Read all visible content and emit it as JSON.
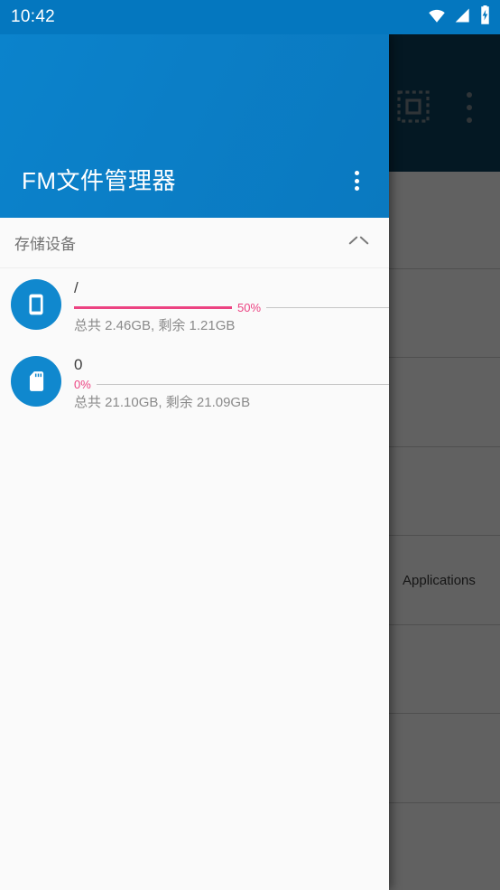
{
  "status_bar": {
    "time": "10:42",
    "icons": [
      "wifi-icon",
      "cellular-signal-icon",
      "battery-charging-icon"
    ],
    "background": "#0477bf"
  },
  "background_app": {
    "toolbar": {
      "background": "#0b3f5e",
      "select_all_icon": "select-all-icon",
      "overflow_icon": "overflow-menu-icon"
    },
    "list_rows": [
      {
        "label": ""
      },
      {
        "label": ""
      },
      {
        "label": ""
      },
      {
        "label": ""
      },
      {
        "label": "Applications"
      },
      {
        "label": ""
      },
      {
        "label": ""
      }
    ]
  },
  "drawer": {
    "header": {
      "title": "FM文件管理器",
      "overflow_icon": "overflow-menu-icon",
      "background": "#0b7ec6"
    },
    "section": {
      "title": "存储设备",
      "collapse_icon": "chevron-up-icon",
      "expanded": true
    },
    "storage_items": [
      {
        "icon": "phone-storage-icon",
        "name": "/",
        "percent_label": "50%",
        "percent": 50,
        "meta": "总共  2.46GB, 剩余  1.21GB",
        "accent": "#ec4382"
      },
      {
        "icon": "sd-card-icon",
        "name": "0",
        "percent_label": "0%",
        "percent": 0,
        "meta": "总共  21.10GB, 剩余  21.09GB",
        "accent": "#ec4382"
      }
    ]
  }
}
